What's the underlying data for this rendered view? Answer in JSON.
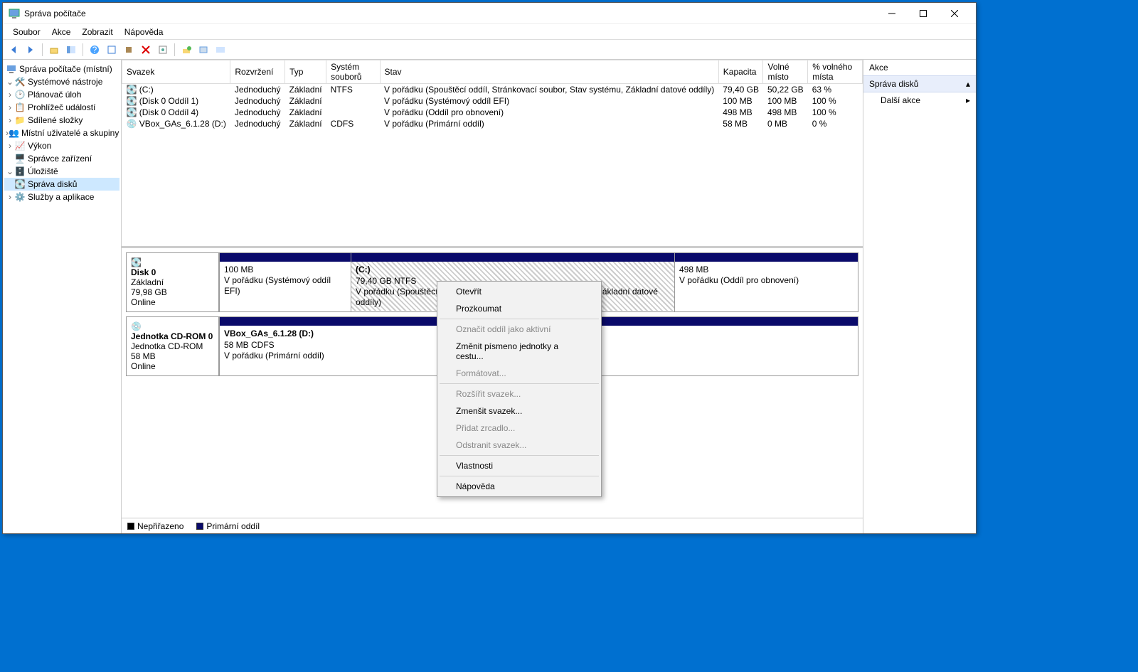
{
  "window": {
    "title": "Správa počítače"
  },
  "menubar": [
    "Soubor",
    "Akce",
    "Zobrazit",
    "Nápověda"
  ],
  "tree": {
    "root": "Správa počítače (místní)",
    "systools": "Systémové nástroje",
    "scheduler": "Plánovač úloh",
    "eventviewer": "Prohlížeč událostí",
    "sharedfolders": "Sdílené složky",
    "localusers": "Místní uživatelé a skupiny",
    "perf": "Výkon",
    "devmgr": "Správce zařízení",
    "storage": "Úložiště",
    "diskmgmt": "Správa disků",
    "services": "Služby a aplikace"
  },
  "columns": [
    "Svazek",
    "Rozvržení",
    "Typ",
    "Systém souborů",
    "Stav",
    "Kapacita",
    "Volné místo",
    "% volného místa"
  ],
  "volumes": [
    {
      "name": "(C:)",
      "layout": "Jednoduchý",
      "type": "Základní",
      "fs": "NTFS",
      "status": "V pořádku (Spouštěcí oddíl, Stránkovací soubor, Stav systému, Základní datové oddíly)",
      "cap": "79,40 GB",
      "free": "50,22 GB",
      "pct": "63 %"
    },
    {
      "name": "(Disk 0 Oddíl 1)",
      "layout": "Jednoduchý",
      "type": "Základní",
      "fs": "",
      "status": "V pořádku (Systémový oddíl EFI)",
      "cap": "100 MB",
      "free": "100 MB",
      "pct": "100 %"
    },
    {
      "name": "(Disk 0 Oddíl 4)",
      "layout": "Jednoduchý",
      "type": "Základní",
      "fs": "",
      "status": "V pořádku (Oddíl pro obnovení)",
      "cap": "498 MB",
      "free": "498 MB",
      "pct": "100 %"
    },
    {
      "name": "VBox_GAs_6.1.28 (D:)",
      "layout": "Jednoduchý",
      "type": "Základní",
      "fs": "CDFS",
      "status": "V pořádku (Primární oddíl)",
      "cap": "58 MB",
      "free": "0 MB",
      "pct": "0 %"
    }
  ],
  "disk0": {
    "title": "Disk 0",
    "type": "Základní",
    "size": "79,98 GB",
    "status": "Online",
    "p1": {
      "size": "100 MB",
      "status": "V pořádku (Systémový oddíl EFI)"
    },
    "p2": {
      "title": "(C:)",
      "size": "79,40 GB NTFS",
      "status": "V pořádku (Spouštěcí oddíl, Stránkovací soubor, Stav systému, Základní datové oddíly)"
    },
    "p3": {
      "size": "498 MB",
      "status": "V pořádku (Oddíl pro obnovení)"
    }
  },
  "cdrom": {
    "title": "Jednotka CD-ROM 0",
    "type": "Jednotka CD-ROM",
    "size": "58 MB",
    "status": "Online",
    "p1": {
      "title": "VBox_GAs_6.1.28  (D:)",
      "size": "58 MB CDFS",
      "status": "V pořádku (Primární oddíl)"
    }
  },
  "legend": {
    "unallocated": "Nepřiřazeno",
    "primary": "Primární oddíl"
  },
  "actions": {
    "header": "Akce",
    "section": "Správa disků",
    "more": "Další akce"
  },
  "context": {
    "open": "Otevřít",
    "explore": "Prozkoumat",
    "markactive": "Označit oddíl jako aktivní",
    "changeletter": "Změnit písmeno jednotky a cestu...",
    "format": "Formátovat...",
    "extend": "Rozšířit svazek...",
    "shrink": "Zmenšit svazek...",
    "mirror": "Přidat zrcadlo...",
    "delete": "Odstranit svazek...",
    "properties": "Vlastnosti",
    "help": "Nápověda"
  }
}
